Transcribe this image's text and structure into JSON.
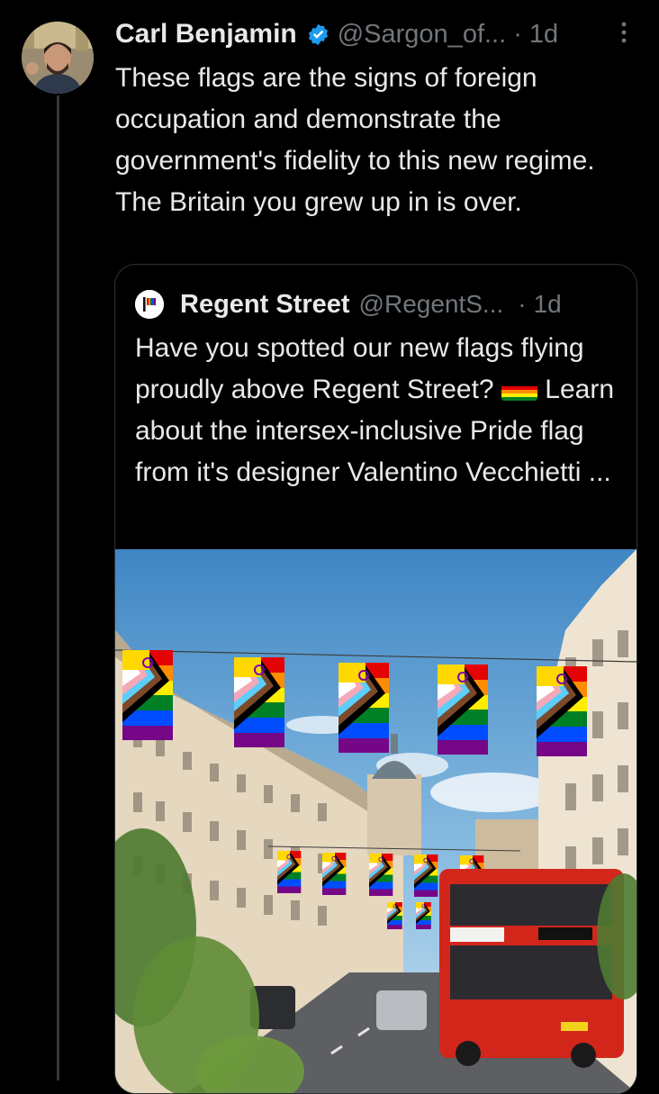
{
  "tweet": {
    "author_name": "Carl Benjamin",
    "handle": "@Sargon_of...",
    "separator": "·",
    "time": "1d",
    "text": "These flags are the signs of foreign occupation and demonstrate the government's fidelity to this new regime. The Britain you grew up in is over."
  },
  "quote": {
    "author_name": "Regent Street",
    "handle": "@RegentS...",
    "separator": "·",
    "time": "1d",
    "text_before_emoji": "Have you spotted our new flags flying proudly above Regent Street? ",
    "emoji": "rainbow-flag-emoji",
    "text_after_emoji": " Learn about the intersex-inclusive Pride flag from it's designer Valentino Vecchietti ..."
  },
  "icons": {
    "verified": "verified-badge-icon",
    "more": "more-options-icon",
    "logo": "regent-street-logo"
  },
  "colors": {
    "background": "#000000",
    "text": "#e7e9ea",
    "muted": "#71767b",
    "verified_blue": "#1d9bf0",
    "border": "#2f3336"
  }
}
